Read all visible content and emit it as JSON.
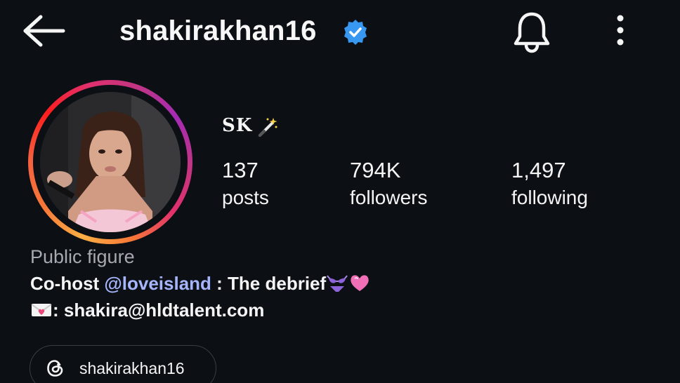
{
  "header": {
    "username": "shakirakhan16",
    "verified": true,
    "back_icon": "arrow-left-icon",
    "notification_icon": "bell-icon",
    "more_icon": "more-vertical-icon"
  },
  "profile": {
    "display_name": "SK",
    "display_name_emoji": "magic-wand-emoji",
    "stats": {
      "posts": {
        "value": "137",
        "label": "posts"
      },
      "followers": {
        "value": "794K",
        "label": "followers"
      },
      "following": {
        "value": "1,497",
        "label": "following"
      }
    },
    "category": "Public figure",
    "bio": {
      "line1_prefix": "Co-host ",
      "line1_mention": "@loveisland",
      "line1_suffix": " : The debrief",
      "line1_emojis": [
        "bikini-emoji",
        "pink-heart-emoji"
      ],
      "line2_emoji": "love-letter-emoji",
      "line2_text": ": shakira@hldtalent.com"
    },
    "threads_link": {
      "icon": "threads-icon",
      "label": "shakirakhan16"
    }
  },
  "colors": {
    "background": "#0c0f14",
    "text": "#f5f5f5",
    "muted": "#a7a9b0",
    "mention": "#a5b4fb",
    "verified_blue": "#3897f0"
  }
}
